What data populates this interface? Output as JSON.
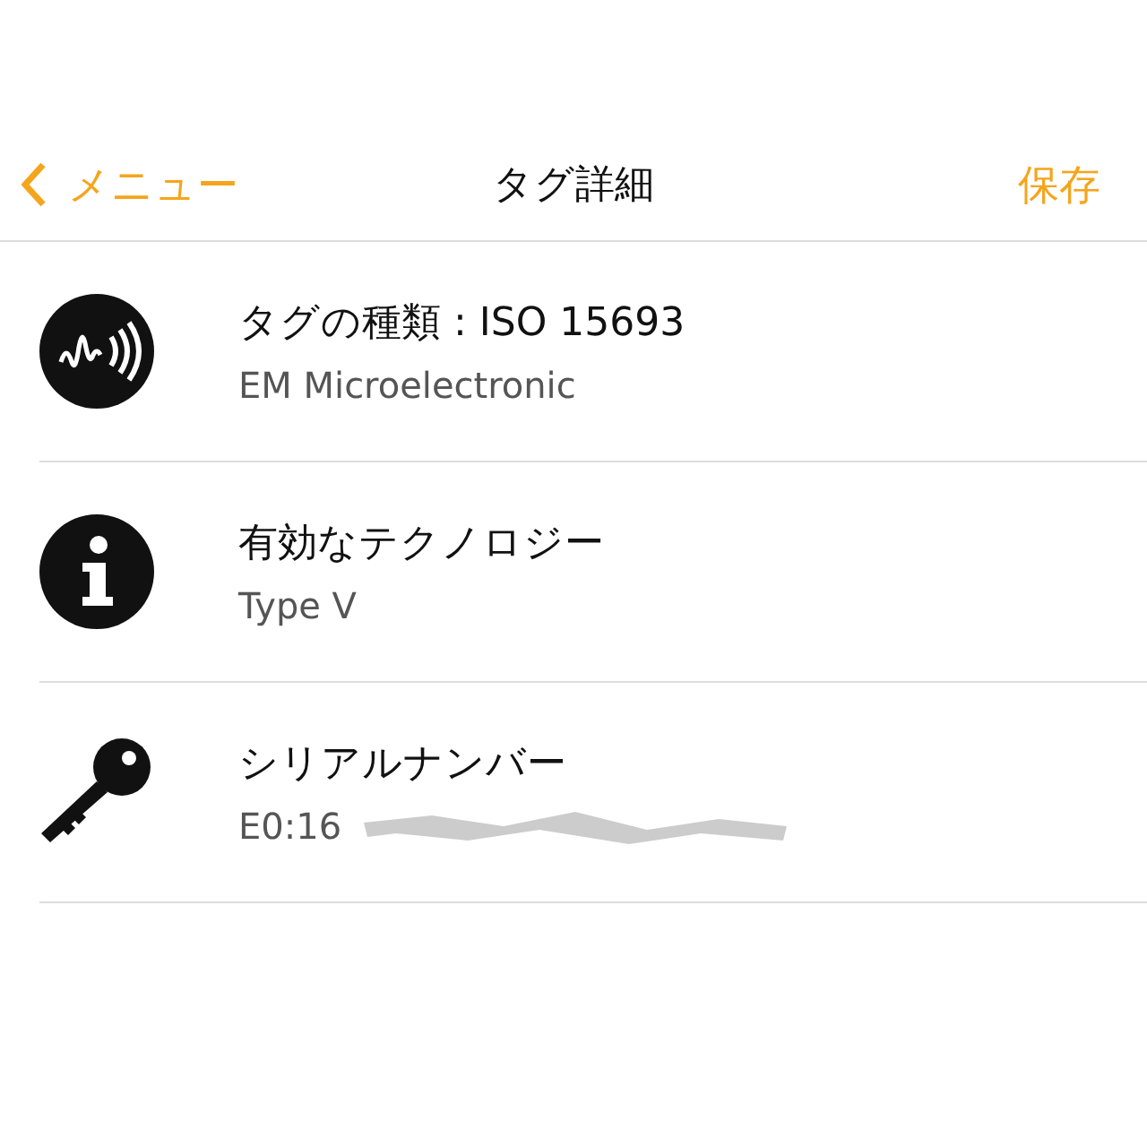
{
  "nav": {
    "back": "メニュー",
    "title": "タグ詳細",
    "action": "保存"
  },
  "rows": [
    {
      "kind": "tag",
      "title": "タグの種類 : ISO 15693",
      "subtitle": "EM Microelectronic"
    },
    {
      "kind": "info",
      "title": "有効なテクノロジー",
      "subtitle": "Type V"
    },
    {
      "kind": "key",
      "title": "シリアルナンバー",
      "subtitle": "E0:16",
      "redacted": true
    }
  ]
}
